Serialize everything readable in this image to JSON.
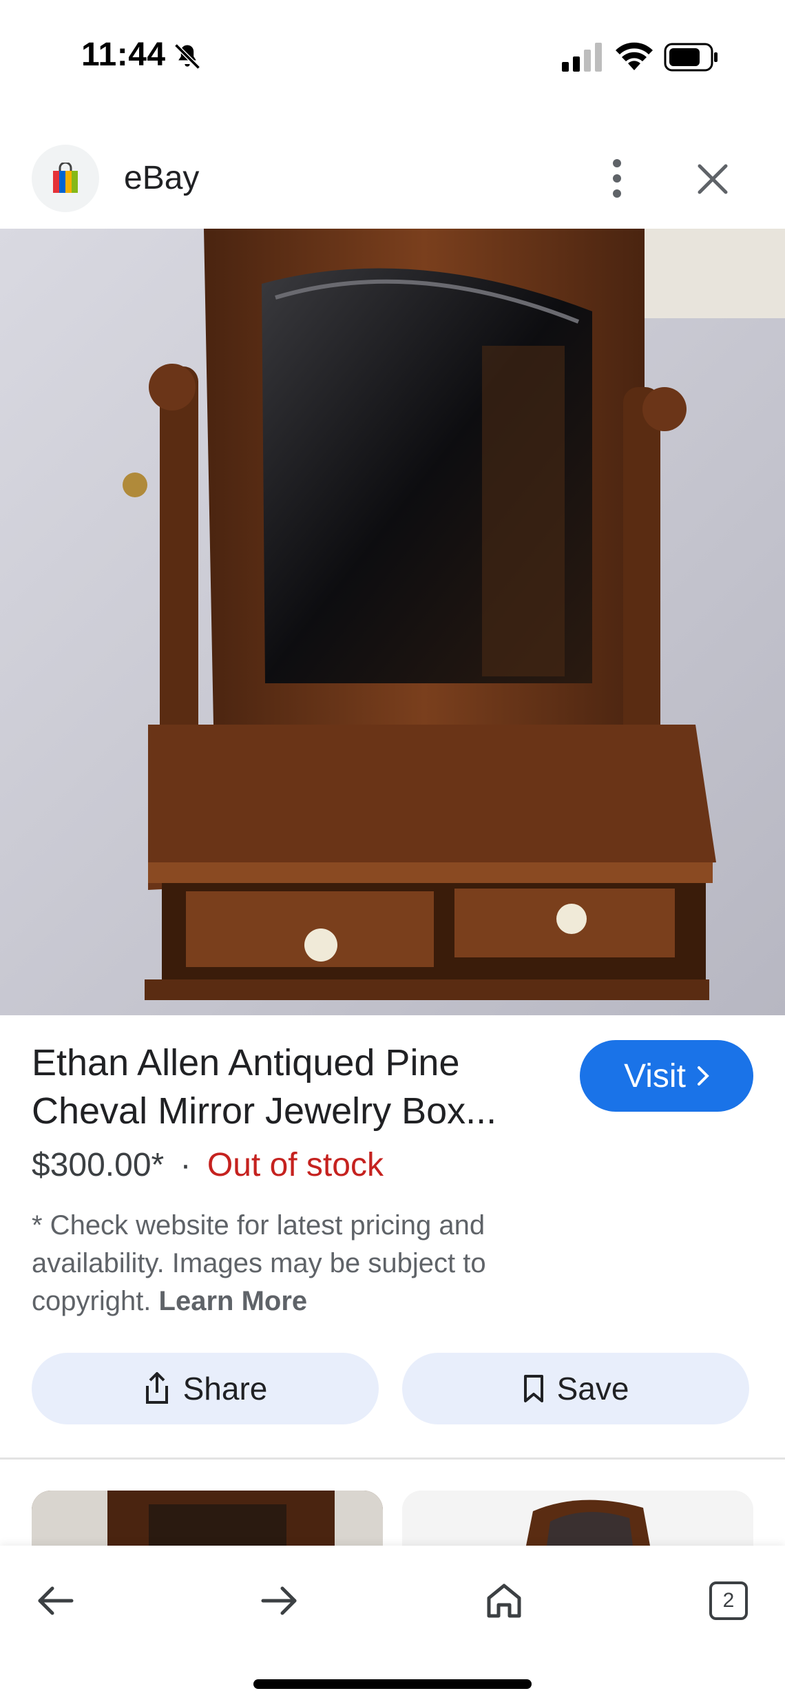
{
  "status_bar": {
    "time": "11:44",
    "icons": [
      "bell-off-icon",
      "signal-icon",
      "wifi-icon",
      "battery-icon"
    ]
  },
  "header": {
    "site_name": "eBay",
    "logo_icon": "shopping-bag-icon",
    "more_icon": "more-vert-icon",
    "close_icon": "close-icon"
  },
  "product": {
    "image_alt": "Ethan Allen antiqued pine cheval mirror jewelry box on bed",
    "title": "Ethan Allen Antiqued Pine Cheval Mirror Jewelry Box...",
    "price": "$300.00*",
    "separator": "·",
    "stock_status": "Out of stock",
    "disclaimer": "* Check website for latest pricing and availability. Images may be subject to copyright.",
    "learn_more": "Learn More"
  },
  "actions": {
    "visit_label": "Visit",
    "share_label": "Share",
    "save_label": "Save"
  },
  "bottom_nav": {
    "tab_count": "2",
    "icons": [
      "back-arrow-icon",
      "forward-arrow-icon",
      "home-icon",
      "tabs-icon"
    ]
  },
  "colors": {
    "accent": "#1a73e8",
    "out_of_stock": "#c5221f",
    "button_bg": "#e8eefb"
  }
}
